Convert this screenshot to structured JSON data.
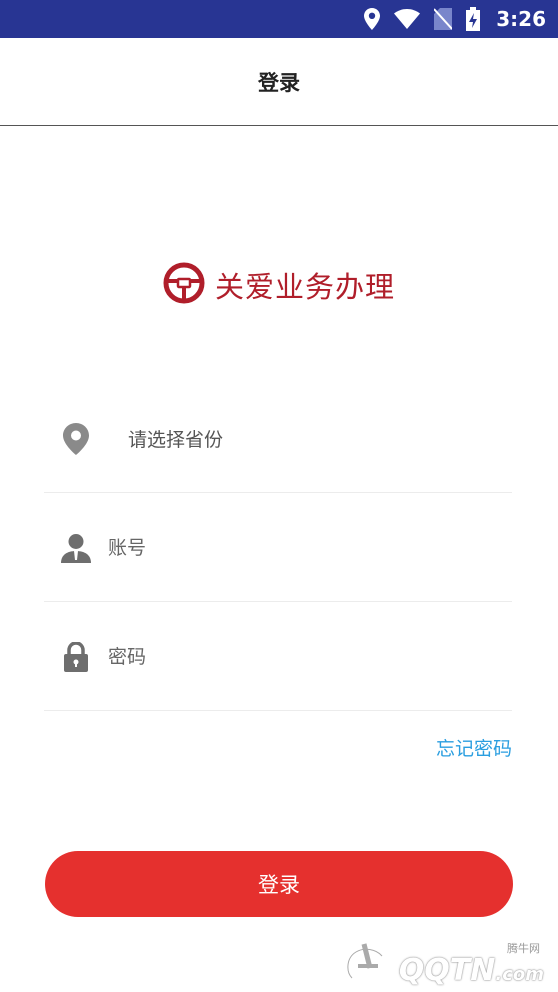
{
  "status_bar": {
    "time": "3:26",
    "background": "#283593",
    "icons": [
      "location-icon",
      "wifi-icon",
      "no-sim-icon",
      "battery-charging-icon"
    ]
  },
  "header": {
    "title": "登录"
  },
  "logo": {
    "icon": "steering-wheel-icon",
    "text": "关爱业务办理",
    "color": "#b01e2a"
  },
  "form": {
    "province": {
      "placeholder": "请选择省份",
      "icon": "location-pin-icon"
    },
    "account": {
      "placeholder": "账号",
      "value": "",
      "icon": "user-icon"
    },
    "password": {
      "placeholder": "密码",
      "value": "",
      "icon": "lock-icon"
    },
    "forgot_label": "忘记密码"
  },
  "login_button": {
    "label": "登录",
    "color": "#e5302e"
  },
  "watermark": {
    "small": "腾牛网",
    "big": "QQTN",
    "suffix": ".com"
  }
}
